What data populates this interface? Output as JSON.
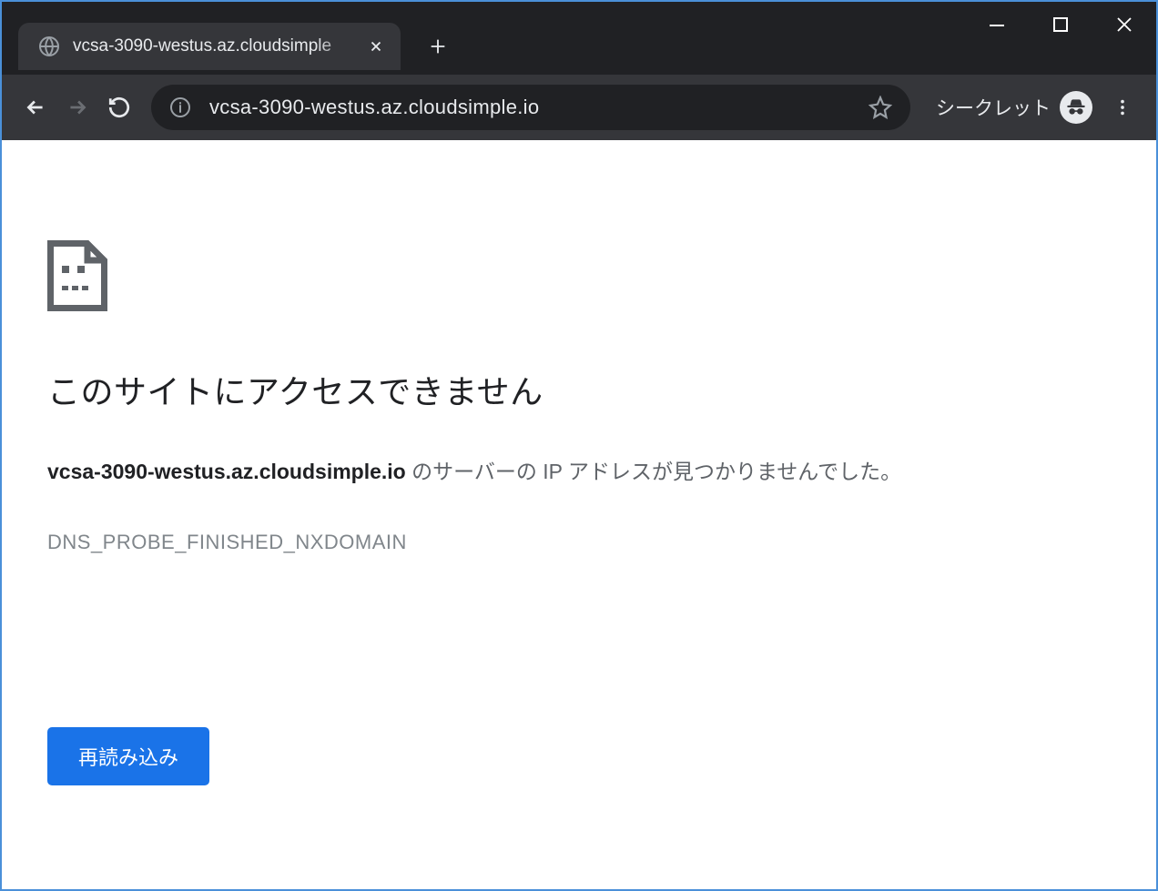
{
  "window": {
    "tab_title": "vcsa-3090-westus.az.cloudsimple"
  },
  "toolbar": {
    "url": "vcsa-3090-westus.az.cloudsimple.io",
    "incognito_label": "シークレット"
  },
  "error_page": {
    "title": "このサイトにアクセスできません",
    "host": "vcsa-3090-westus.az.cloudsimple.io",
    "desc_suffix": " のサーバーの IP アドレスが見つかりませんでした。",
    "error_code": "DNS_PROBE_FINISHED_NXDOMAIN",
    "reload_label": "再読み込み"
  }
}
